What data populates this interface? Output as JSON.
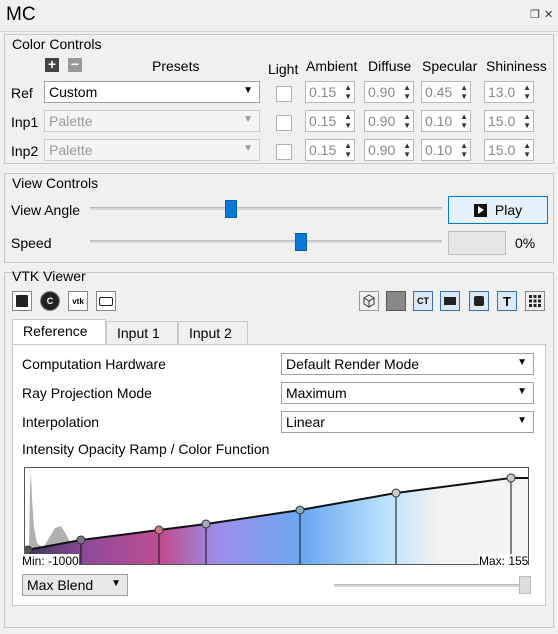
{
  "window": {
    "title": "MC",
    "float_icon": "float-icon",
    "close_icon": "close-icon"
  },
  "color_controls": {
    "group_label": "Color Controls",
    "add_icon": "plus-icon",
    "remove_icon": "minus-icon",
    "headers": {
      "presets": "Presets",
      "light": "Light",
      "ambient": "Ambient",
      "diffuse": "Diffuse",
      "specular": "Specular",
      "shininess": "Shininess"
    },
    "rows": [
      {
        "label": "Ref",
        "preset": "Custom",
        "ambient": "0.15",
        "diffuse": "0.90",
        "specular": "0.45",
        "shininess": "13.0"
      },
      {
        "label": "Inp1",
        "preset": "Palette",
        "ambient": "0.15",
        "diffuse": "0.90",
        "specular": "0.10",
        "shininess": "15.0"
      },
      {
        "label": "Inp2",
        "preset": "Palette",
        "ambient": "0.15",
        "diffuse": "0.90",
        "specular": "0.10",
        "shininess": "15.0"
      }
    ]
  },
  "view_controls": {
    "group_label": "View Controls",
    "view_angle_label": "View Angle",
    "view_angle_value": 0.4,
    "play_label": "Play",
    "speed_label": "Speed",
    "speed_value": 0.6,
    "progress_text": "0%"
  },
  "vtk_viewer": {
    "group_label": "VTK Viewer",
    "left_icons": [
      "save-icon",
      "camera-reset-icon",
      "vtk-icon",
      "screenshot-icon"
    ],
    "left_icon_texts": [
      "",
      "",
      "vtk",
      ""
    ],
    "right_icons": [
      "wireframe-cube-icon",
      "volume-icon",
      "ct-icon",
      "slab-icon",
      "mip-icon",
      "text-icon",
      "grid-icon"
    ],
    "right_icon_texts": [
      "",
      "",
      "CT",
      "",
      "",
      "T",
      ""
    ],
    "tabs": [
      "Reference",
      "Input 1",
      "Input 2"
    ],
    "active_tab": "Reference",
    "fields": [
      {
        "label": "Computation Hardware",
        "value": "Default Render Mode"
      },
      {
        "label": "Ray Projection Mode",
        "value": "Maximum"
      },
      {
        "label": "Interpolation",
        "value": "Linear"
      }
    ],
    "ramp_label": "Intensity Opacity Ramp / Color Function",
    "min_label": "Min: -1000",
    "max_label": "Max: 155",
    "blend_mode": "Max Blend",
    "blend_value": 1.0
  }
}
